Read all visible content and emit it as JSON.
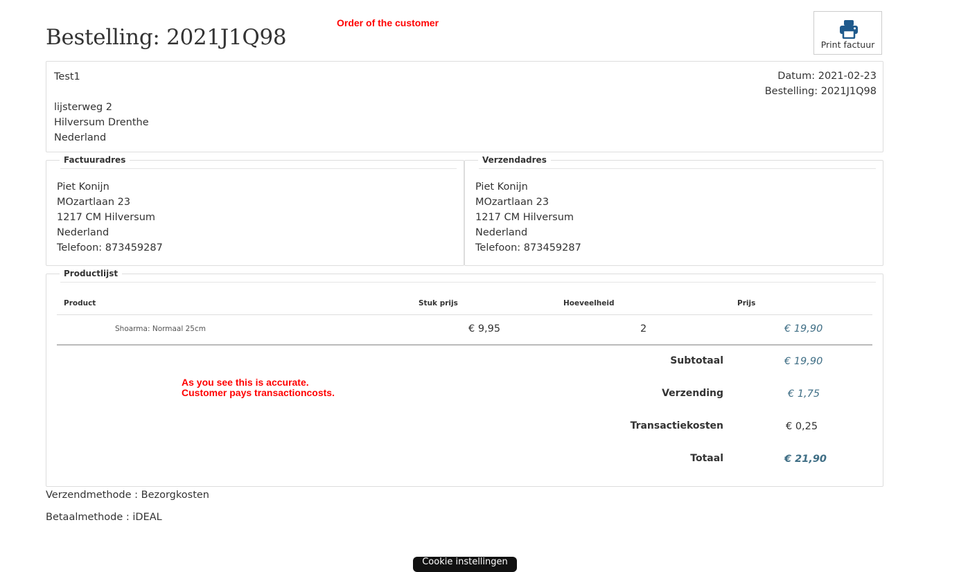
{
  "header": {
    "title": "Bestelling: 2021J1Q98",
    "annotation_top": "Order of the customer",
    "print_label": "Print factuur"
  },
  "customer": {
    "name": "Test1",
    "street": "lijsterweg 2",
    "city": "Hilversum Drenthe",
    "country": "Nederland",
    "date": "Datum: 2021-02-23",
    "order": "Bestelling: 2021J1Q98"
  },
  "billing": {
    "legend": "Factuuradres",
    "name": "Piet Konijn",
    "street": "MOzartlaan 23",
    "city": "1217 CM Hilversum",
    "country": "Nederland",
    "phone": "Telefoon: 873459287"
  },
  "shipping": {
    "legend": "Verzendadres",
    "name": "Piet Konijn",
    "street": "MOzartlaan 23",
    "city": "1217 CM Hilversum",
    "country": "Nederland",
    "phone": "Telefoon: 873459287"
  },
  "products": {
    "legend": "Productlijst",
    "columns": [
      "Product",
      "Stuk prijs",
      "Hoeveelheid",
      "Prijs"
    ],
    "rows": [
      {
        "name": "Shoarma: Normaal 25cm",
        "unit_price": "€ 9,95",
        "qty": "2",
        "price": "€ 19,90"
      }
    ],
    "subtotal_label": "Subtotaal",
    "subtotal": "€ 19,90",
    "shipping_label": "Verzending",
    "shipping": "€ 1,75",
    "transaction_label": "Transactiekosten",
    "transaction": "€ 0,25",
    "total_label": "Totaal",
    "total": "€ 21,90",
    "annotation_line1": "As you see this is accurate.",
    "annotation_line2": "Customer pays transactioncosts."
  },
  "footer": {
    "shipping_method": "Verzendmethode : Bezorgkosten",
    "payment_method": "Betaalmethode : iDEAL",
    "cookie_button": "Cookie instellingen"
  },
  "colors": {
    "annotation": "#ff0000",
    "price_accent": "#3f6e85",
    "print_icon": "#1f5a8c"
  }
}
